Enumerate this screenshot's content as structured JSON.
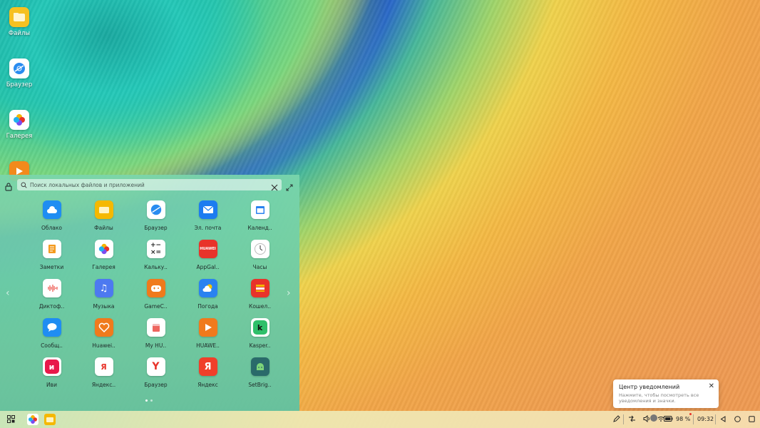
{
  "desktop": {
    "icons": [
      {
        "label": "Файлы",
        "icon": "folder-icon"
      },
      {
        "label": "Браузер",
        "icon": "browser-icon"
      },
      {
        "label": "Галерея",
        "icon": "gallery-icon"
      },
      {
        "label": "",
        "icon": "video-icon"
      }
    ]
  },
  "launcher": {
    "search_placeholder": "Поиск локальных файлов и приложений",
    "apps": [
      {
        "label": "Облако",
        "icon": "cloud-icon",
        "color": "#1f8df2"
      },
      {
        "label": "Файлы",
        "icon": "folder-icon",
        "color": "#f5b800"
      },
      {
        "label": "Браузер",
        "icon": "browser-icon",
        "color": "#ffffff"
      },
      {
        "label": "Эл. почта",
        "icon": "mail-icon",
        "color": "#1c7cf0"
      },
      {
        "label": "Календ..",
        "icon": "calendar-icon",
        "color": "#ffffff"
      },
      {
        "label": "Заметки",
        "icon": "notes-icon",
        "color": "#ffffff"
      },
      {
        "label": "Галерея",
        "icon": "gallery-icon",
        "color": "#ffffff"
      },
      {
        "label": "Кальку..",
        "icon": "calculator-icon",
        "color": "#ffffff"
      },
      {
        "label": "AppGal..",
        "icon": "appgallery-icon",
        "color": "#e8332a"
      },
      {
        "label": "Часы",
        "icon": "clock-icon",
        "color": "#ffffff"
      },
      {
        "label": "Диктоф..",
        "icon": "recorder-icon",
        "color": "#ffffff"
      },
      {
        "label": "Музыка",
        "icon": "music-icon",
        "color": "#4d79f0"
      },
      {
        "label": "GameC..",
        "icon": "gamecenter-icon",
        "color": "#f07a1c"
      },
      {
        "label": "Погода",
        "icon": "weather-icon",
        "color": "#2a82f0"
      },
      {
        "label": "Кошел..",
        "icon": "wallet-icon",
        "color": "#e8332a"
      },
      {
        "label": "Сообщ..",
        "icon": "messages-icon",
        "color": "#1f8df2"
      },
      {
        "label": "Huawei..",
        "icon": "health-icon",
        "color": "#f07a1c"
      },
      {
        "label": "My HU..",
        "icon": "myhuawei-icon",
        "color": "#ffffff"
      },
      {
        "label": "HUAWE..",
        "icon": "huawei-video-icon",
        "color": "#f07a1c"
      },
      {
        "label": "Kasper..",
        "icon": "kaspersky-icon",
        "color": "#ffffff"
      },
      {
        "label": "Иви",
        "icon": "ivi-icon",
        "color": "#ffffff"
      },
      {
        "label": "Яндекс..",
        "icon": "yandex-market-icon",
        "color": "#ffffff"
      },
      {
        "label": "Браузер",
        "icon": "yandex-browser-icon",
        "color": "#ffffff"
      },
      {
        "label": "Яндекс",
        "icon": "yandex-icon",
        "color": "#f03f2a"
      },
      {
        "label": "SetBrig..",
        "icon": "android-icon",
        "color": "#2a6a6a"
      }
    ],
    "page_indicator": {
      "pages": 2,
      "current": 1
    }
  },
  "notification": {
    "title": "Центр уведомлений",
    "description": "Нажмите, чтобы посмотреть все уведомления и значки."
  },
  "taskbar": {
    "battery": "98 %",
    "time": "09:32"
  }
}
